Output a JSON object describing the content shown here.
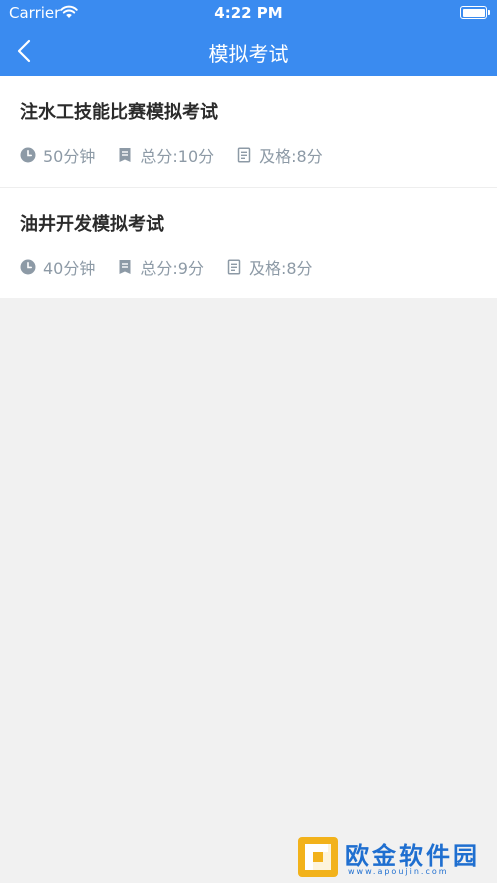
{
  "statusbar": {
    "carrier": "Carrier",
    "time": "4:22 PM"
  },
  "navbar": {
    "title": "模拟考试"
  },
  "exams": [
    {
      "title": "注水工技能比赛模拟考试",
      "duration": "50分钟",
      "total": "总分:10分",
      "pass": "及格:8分"
    },
    {
      "title": "油井开发模拟考试",
      "duration": "40分钟",
      "total": "总分:9分",
      "pass": "及格:8分"
    }
  ],
  "watermark": {
    "name": "欧金软件园",
    "url": "www.apoujin.com"
  },
  "colors": {
    "primary": "#3a8bf0",
    "meta": "#8d9aa6",
    "background": "#f1f1f1"
  }
}
